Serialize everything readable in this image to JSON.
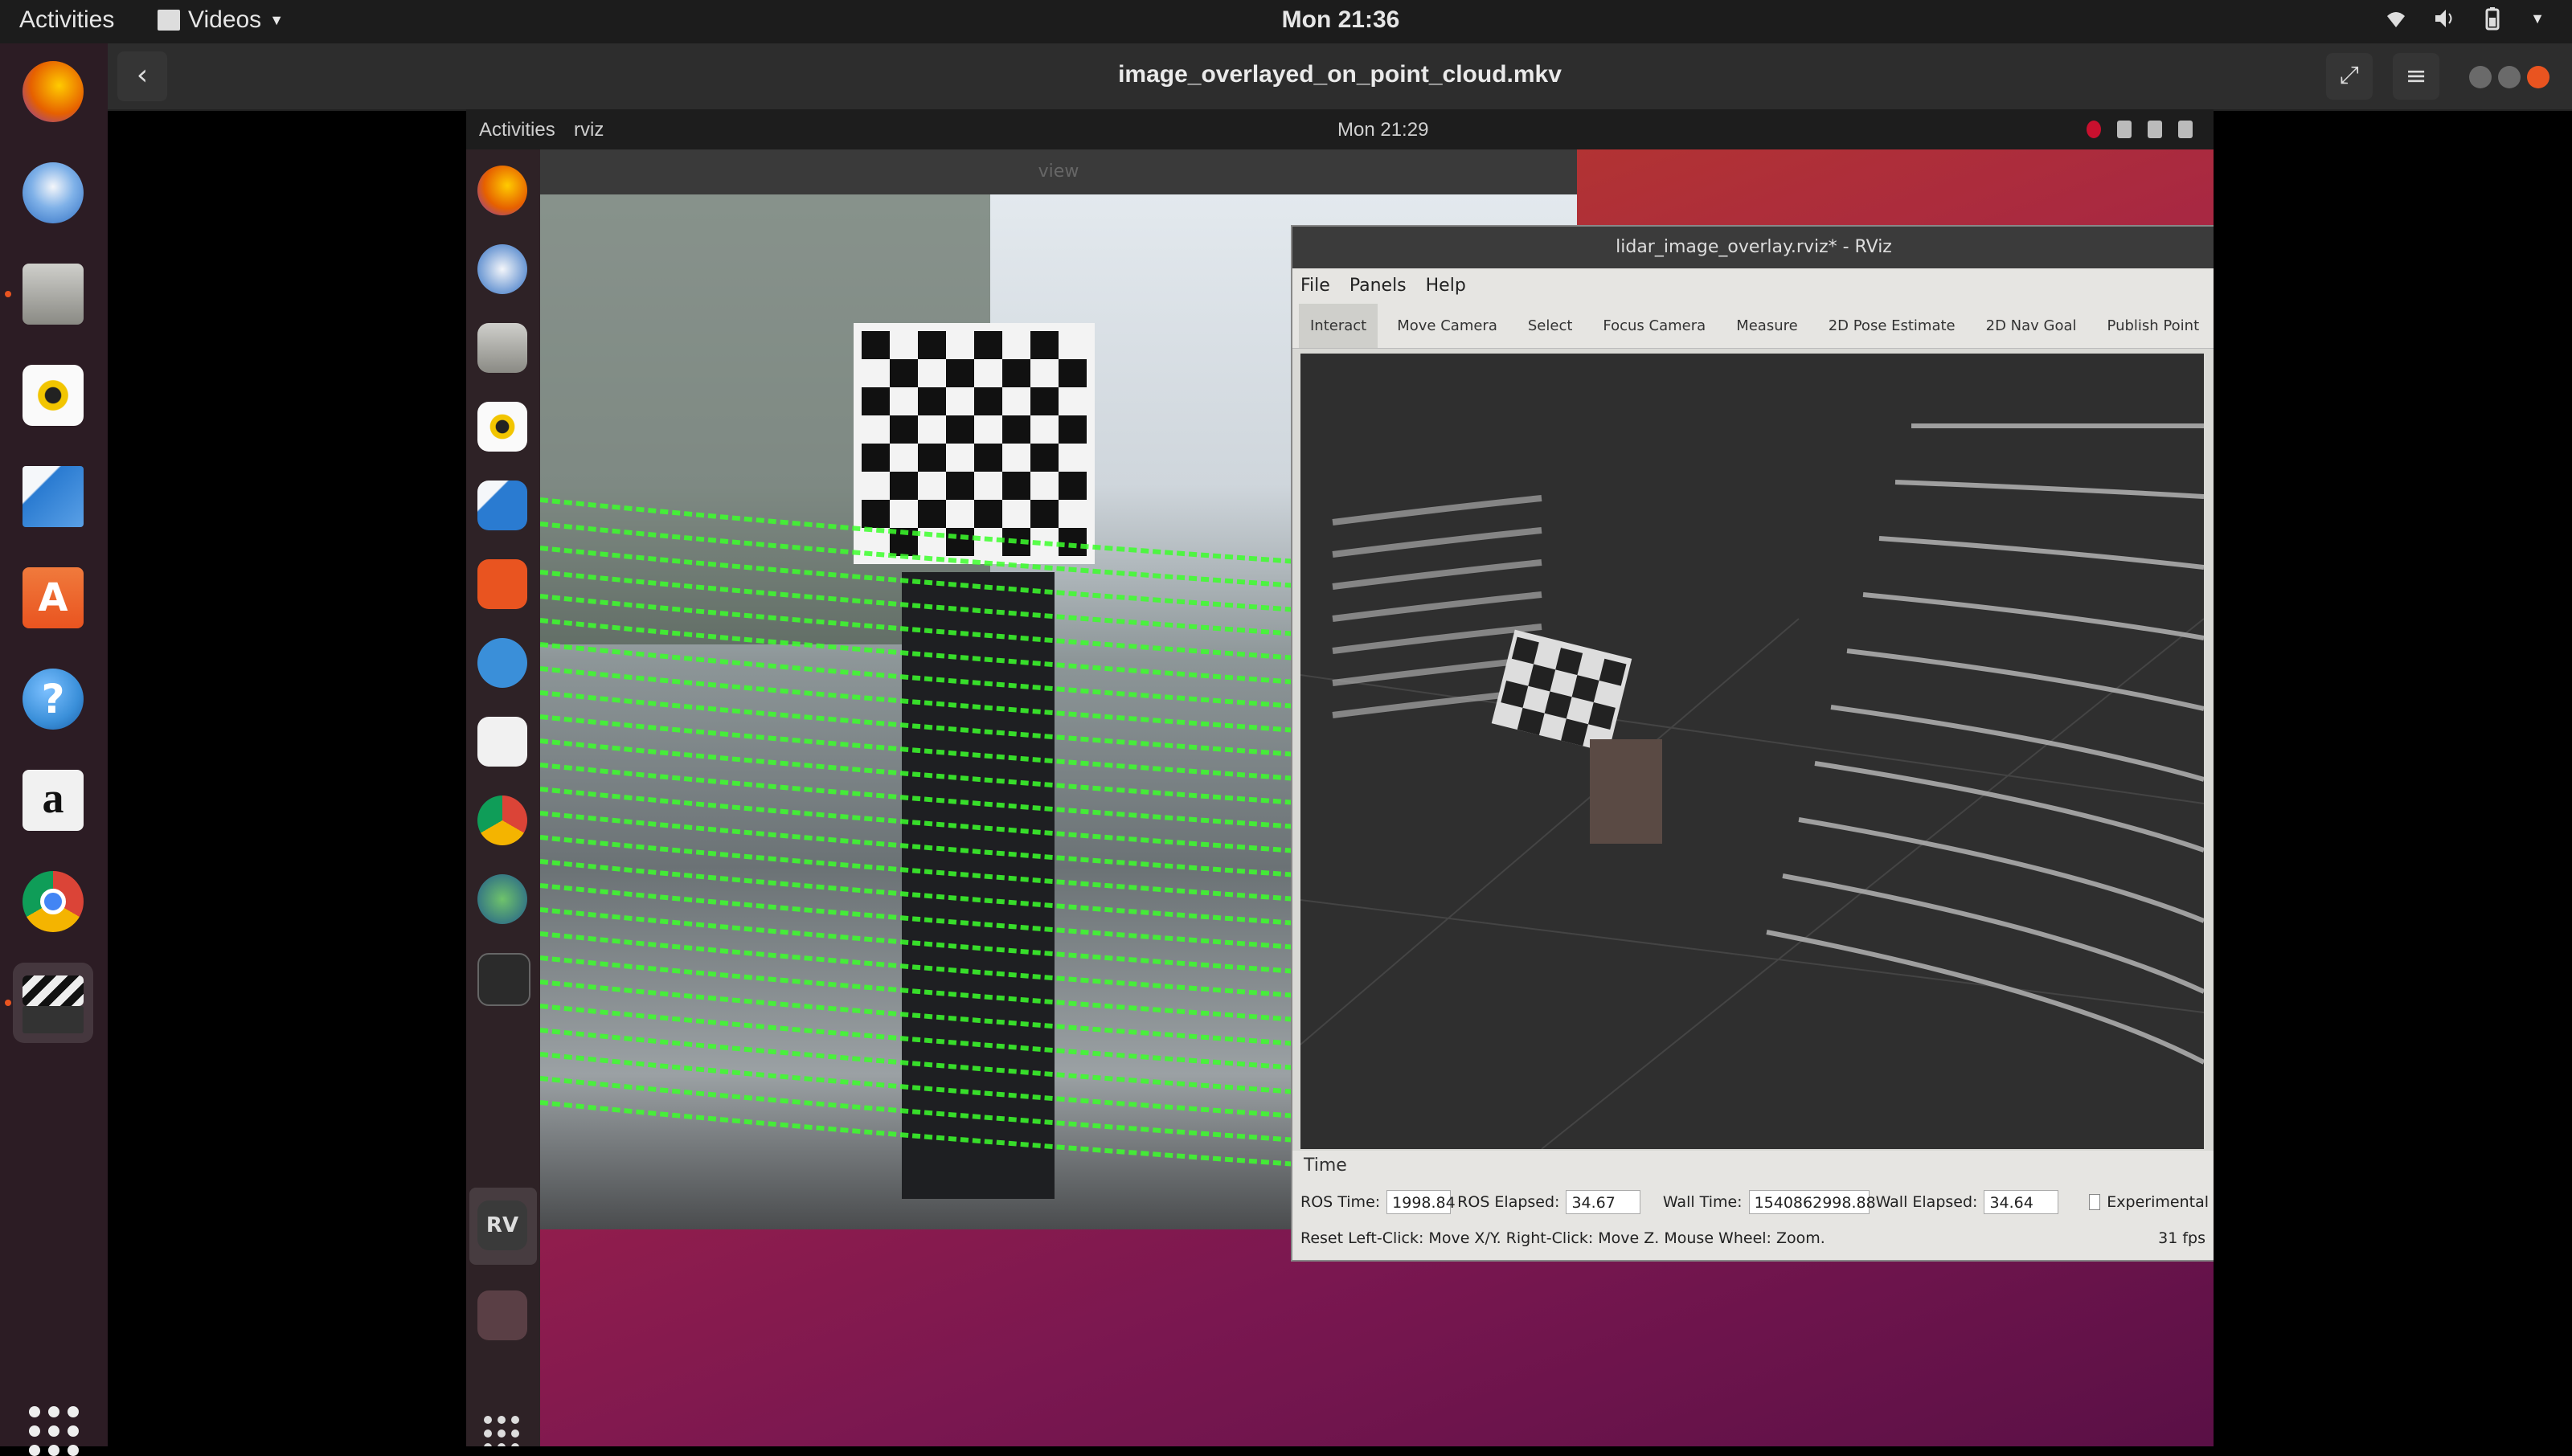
{
  "topbar": {
    "activities": "Activities",
    "app_menu": "Videos",
    "clock": "Mon 21:36"
  },
  "dock": {
    "items": [
      {
        "name": "firefox-icon",
        "color": "#e66000"
      },
      {
        "name": "thunderbird-icon",
        "color": "#2f6ec2"
      },
      {
        "name": "files-icon",
        "color": "#8a8a84"
      },
      {
        "name": "rhythmbox-icon",
        "color": "#f2c500"
      },
      {
        "name": "libreoffice-writer-icon",
        "color": "#2a7bd1"
      },
      {
        "name": "ubuntu-software-icon",
        "color": "#e95420"
      },
      {
        "name": "help-icon",
        "color": "#3a8fd9"
      },
      {
        "name": "amazon-icon",
        "color": "#f1f1f1"
      },
      {
        "name": "chrome-icon",
        "color": "#db4437"
      },
      {
        "name": "videos-icon",
        "color": "#4a4a4a"
      }
    ]
  },
  "headerbar": {
    "title": "image_overlayed_on_point_cloud.mkv"
  },
  "video": {
    "topbar": {
      "activities": "Activities",
      "app_name": "rviz",
      "clock": "Mon 21:29"
    },
    "camera_window_title": "view",
    "rviz": {
      "title": "lidar_image_overlay.rviz* - RViz",
      "menu": [
        "File",
        "Panels",
        "Help"
      ],
      "tools": [
        "Interact",
        "Move Camera",
        "Select",
        "Focus Camera",
        "Measure",
        "2D Pose Estimate",
        "2D Nav Goal",
        "Publish Point"
      ],
      "time_panel_title": "Time",
      "ros_time_label": "ROS Time:",
      "ros_time": "1998.84",
      "ros_elapsed_label": "ROS Elapsed:",
      "ros_elapsed": "34.67",
      "wall_time_label": "Wall Time:",
      "wall_time": "1540862998.88",
      "wall_elapsed_label": "Wall Elapsed:",
      "wall_elapsed": "34.64",
      "experimental": "Experimental",
      "status": "Reset   Left-Click: Move X/Y. Right-Click: Move Z. Mouse Wheel: Zoom.",
      "fps": "31 fps"
    }
  }
}
